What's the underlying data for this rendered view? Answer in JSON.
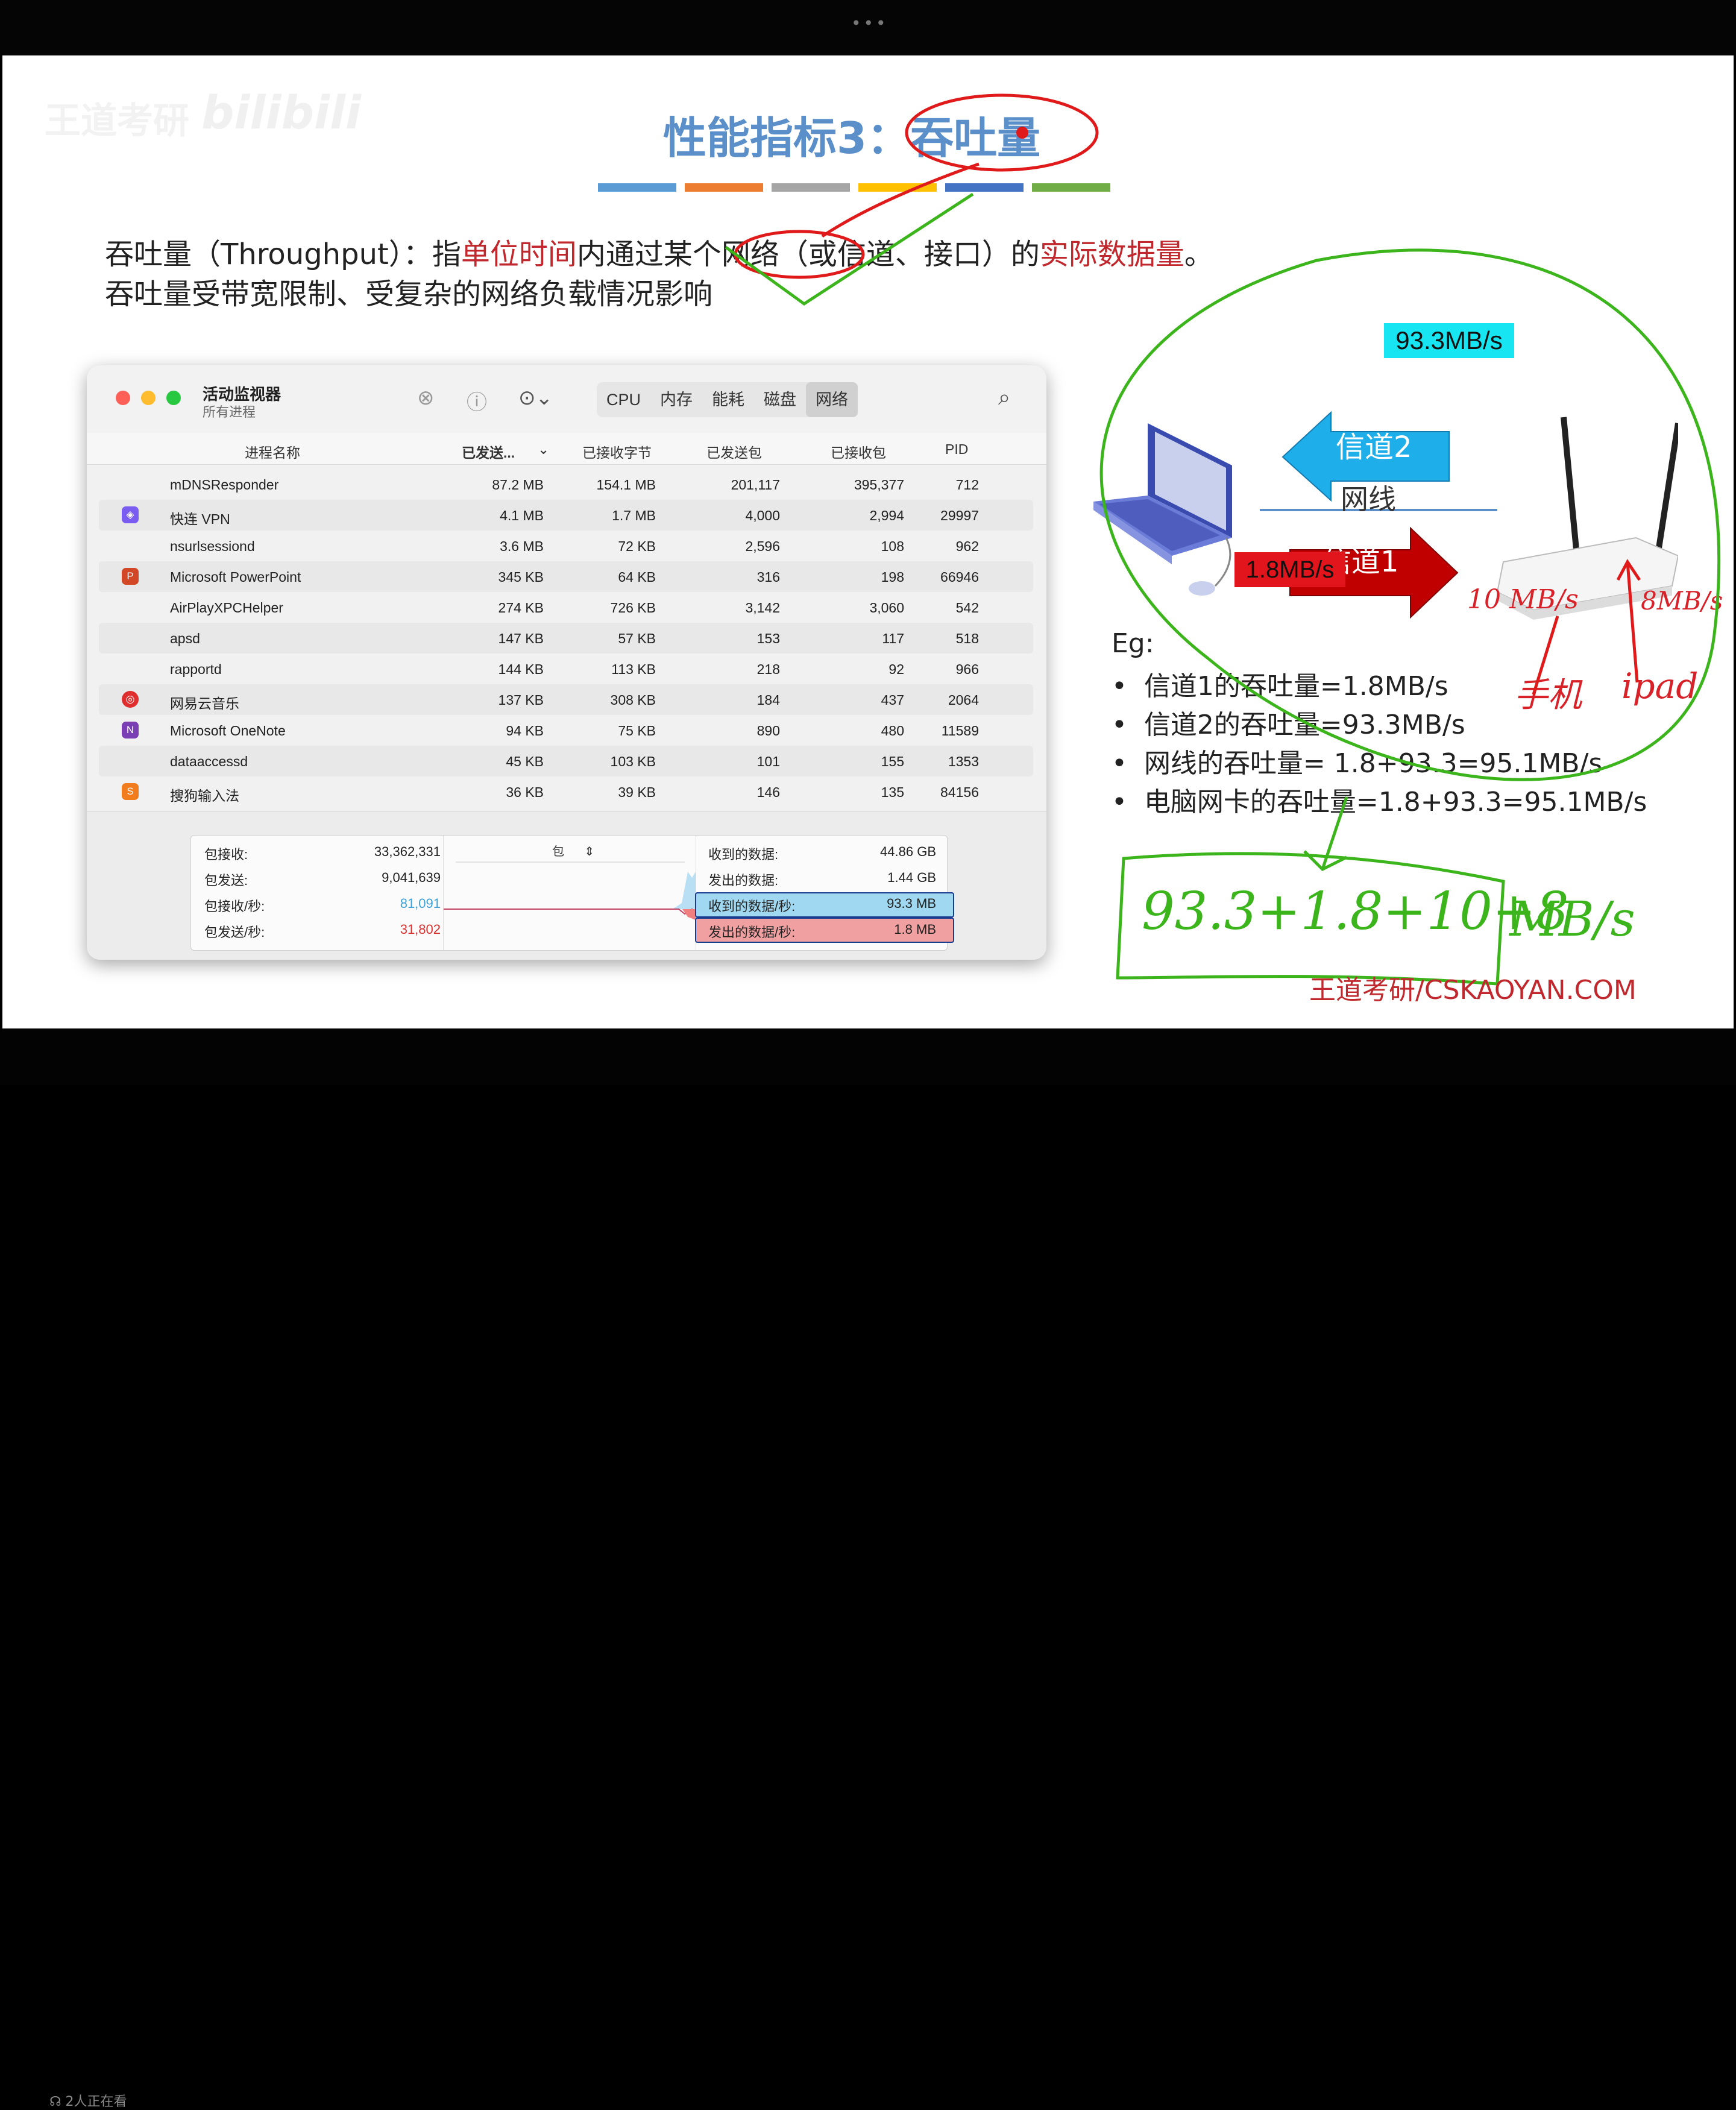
{
  "slide": {
    "watermark": "王道考研",
    "watermark_logo": "bilibili",
    "title": "性能指标3：吞吐量",
    "title_color": "#5b8fc9",
    "bar_colors": [
      "#5b9bd5",
      "#ed7d31",
      "#a5a5a5",
      "#ffc000",
      "#4472c4",
      "#70ad47"
    ],
    "definition": {
      "p1": "吞吐量（Throughput）：指",
      "p2": "单位时间",
      "p3": "内通过某个网络（或信道、接口）的",
      "p4": "实际数据量",
      "p5": "。"
    },
    "line2": "吞吐量受带宽限制、受复杂的网络负载情况影响",
    "credit": "王道考研/CSKAOYAN.COM"
  },
  "activity_monitor": {
    "title": "活动监视器",
    "subtitle": "所有进程",
    "tabs": [
      "CPU",
      "内存",
      "能耗",
      "磁盘",
      "网络"
    ],
    "active_tab": "网络",
    "columns": {
      "name": "进程名称",
      "sent": "已发送...",
      "recv": "已接收字节",
      "sent_packets": "已发送包",
      "recv_packets": "已接收包",
      "pid": "PID"
    },
    "rows": [
      {
        "name": "mDNSResponder",
        "sent": "87.2 MB",
        "recv": "154.1 MB",
        "sp": "201,117",
        "rp": "395,377",
        "pid": "712"
      },
      {
        "name": "快连 VPN",
        "sent": "4.1 MB",
        "recv": "1.7 MB",
        "sp": "4,000",
        "rp": "2,994",
        "pid": "29997"
      },
      {
        "name": "nsurlsessiond",
        "sent": "3.6 MB",
        "recv": "72 KB",
        "sp": "2,596",
        "rp": "108",
        "pid": "962"
      },
      {
        "name": "Microsoft PowerPoint",
        "sent": "345 KB",
        "recv": "64 KB",
        "sp": "316",
        "rp": "198",
        "pid": "66946"
      },
      {
        "name": "AirPlayXPCHelper",
        "sent": "274 KB",
        "recv": "726 KB",
        "sp": "3,142",
        "rp": "3,060",
        "pid": "542"
      },
      {
        "name": "apsd",
        "sent": "147 KB",
        "recv": "57 KB",
        "sp": "153",
        "rp": "117",
        "pid": "518"
      },
      {
        "name": "rapportd",
        "sent": "144 KB",
        "recv": "113 KB",
        "sp": "218",
        "rp": "92",
        "pid": "966"
      },
      {
        "name": "网易云音乐",
        "sent": "137 KB",
        "recv": "308 KB",
        "sp": "184",
        "rp": "437",
        "pid": "2064"
      },
      {
        "name": "Microsoft OneNote",
        "sent": "94 KB",
        "recv": "75 KB",
        "sp": "890",
        "rp": "480",
        "pid": "11589"
      },
      {
        "name": "dataaccessd",
        "sent": "45 KB",
        "recv": "103 KB",
        "sp": "101",
        "rp": "155",
        "pid": "1353"
      },
      {
        "name": "搜狗输入法",
        "sent": "36 KB",
        "recv": "39 KB",
        "sp": "146",
        "rp": "135",
        "pid": "84156"
      }
    ],
    "stats": {
      "pkts_in_label": "包接收:",
      "pkts_in": "33,362,331",
      "pkts_out_label": "包发送:",
      "pkts_out": "9,041,639",
      "pkts_in_sec_label": "包接收/秒:",
      "pkts_in_sec": "81,091",
      "pkts_out_sec_label": "包发送/秒:",
      "pkts_out_sec": "31,802",
      "graph_mode": "包",
      "data_in_label": "收到的数据:",
      "data_in": "44.86 GB",
      "data_out_label": "发出的数据:",
      "data_out": "1.44 GB",
      "data_in_sec_label": "收到的数据/秒:",
      "data_in_sec": "93.3 MB",
      "data_out_sec_label": "发出的数据/秒:",
      "data_out_sec": "1.8 MB"
    }
  },
  "diagram": {
    "channel2_rate": "93.3MB/s",
    "channel2": "信道2",
    "wire": "网线",
    "channel1": "信道1",
    "channel1_rate": "1.8MB/s"
  },
  "example": {
    "eg": "Eg:",
    "items": [
      "信道1的吞吐量=1.8MB/s",
      "信道2的吞吐量=93.3MB/s",
      "网线的吞吐量= 1.8+93.3=95.1MB/s",
      "电脑网卡的吞吐量=1.8+93.3=95.1MB/s"
    ]
  },
  "handwriting": {
    "down_rate": "10 MB/s",
    "up_rate": "8MB/s",
    "phone": "手机",
    "ipad": "ipad",
    "formula": "93.3+1.8+10+8",
    "unit": "MB/s"
  },
  "overlay": {
    "viewers": "2人正在看"
  }
}
